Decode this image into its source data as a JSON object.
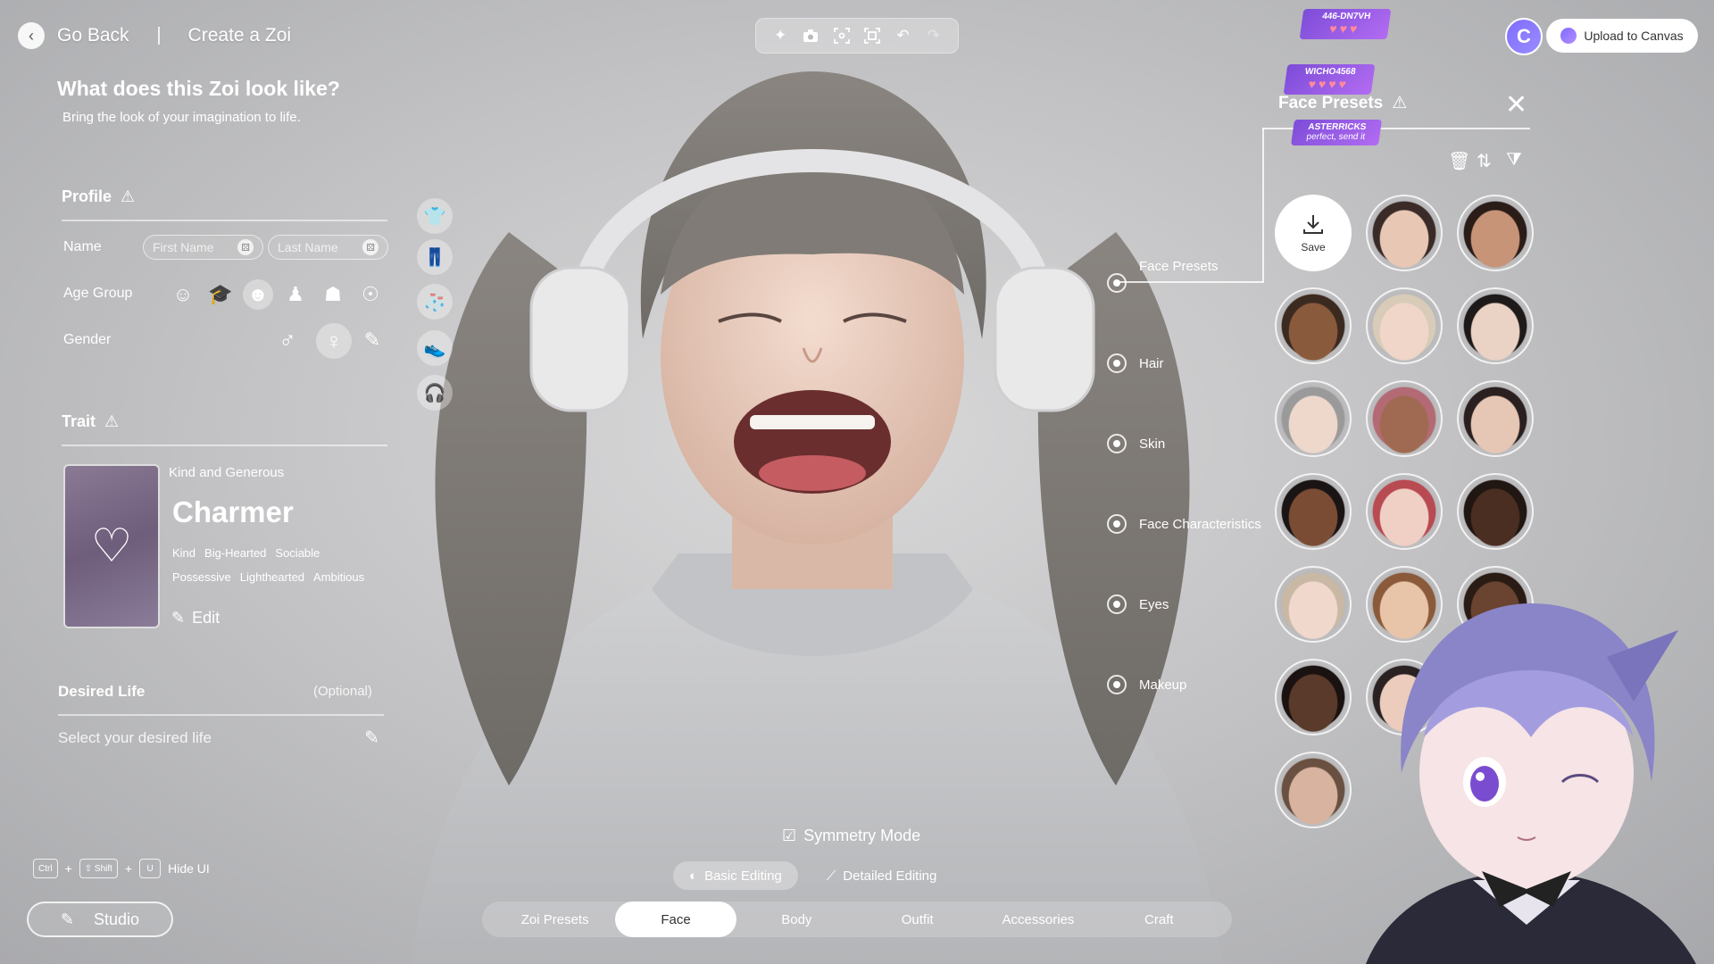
{
  "header": {
    "back_label": "Go Back",
    "title": "Create a Zoi"
  },
  "toolbar": {
    "tools": [
      "sparkle-icon",
      "camera-icon",
      "focus-icon",
      "capture-icon",
      "undo-icon",
      "redo-icon"
    ]
  },
  "top_right": {
    "upload_label": "Upload to Canvas",
    "canvas_badge": "C"
  },
  "main": {
    "heading": "What does this Zoi look like?",
    "subheading": "Bring the look of your imagination to life."
  },
  "profile": {
    "title": "Profile",
    "name_label": "Name",
    "first_name_placeholder": "First Name",
    "last_name_placeholder": "Last Name",
    "age_label": "Age Group",
    "gender_label": "Gender"
  },
  "trait": {
    "title": "Trait",
    "subtitle": "Kind and Generous",
    "name": "Charmer",
    "tags_row1": [
      "Kind",
      "Big-Hearted",
      "Sociable"
    ],
    "tags_row2": [
      "Possessive",
      "Lighthearted",
      "Ambitious"
    ],
    "edit_label": "Edit"
  },
  "desired_life": {
    "title": "Desired Life",
    "optional": "(Optional)",
    "placeholder": "Select your desired life"
  },
  "face_menu": {
    "items": [
      "Face Presets",
      "Hair",
      "Skin",
      "Face Characteristics",
      "Eyes",
      "Makeup"
    ]
  },
  "presets": {
    "title": "Face Presets",
    "save_label": "Save",
    "faces": [
      {
        "skin": "#e8c8b4",
        "hair": "#3a2b28"
      },
      {
        "skin": "#c89478",
        "hair": "#2a1d18"
      },
      {
        "skin": "#8a5a3c",
        "hair": "#3b2a20"
      },
      {
        "skin": "#efd6c8",
        "hair": "#d8cbb8"
      },
      {
        "skin": "#ead2c4",
        "hair": "#1f1a1a"
      },
      {
        "skin": "#eed8cc",
        "hair": "#9a9a9a"
      },
      {
        "skin": "#a06a52",
        "hair": "#b46a74"
      },
      {
        "skin": "#e6c6b4",
        "hair": "#2a2020"
      },
      {
        "skin": "#7a4c34",
        "hair": "#1a1414"
      },
      {
        "skin": "#f0d0c4",
        "hair": "#b84a52"
      },
      {
        "skin": "#4a2e22",
        "hair": "#201612"
      },
      {
        "skin": "#f0d8cc",
        "hair": "#c8b8a4"
      },
      {
        "skin": "#e8c4a8",
        "hair": "#8a5a3a"
      },
      {
        "skin": "#6a4430",
        "hair": "#2a1c14"
      },
      {
        "skin": "#5a3a2a",
        "hair": "#1a1210"
      },
      {
        "skin": "#ecccbc",
        "hair": "#2a2222"
      },
      {
        "skin": "#e8c8b8",
        "hair": "#2a2020"
      },
      {
        "skin": "#d8b4a0",
        "hair": "#6a5040"
      }
    ]
  },
  "chat": [
    {
      "user": "446-DN7VH",
      "msg": ""
    },
    {
      "user": "WICHO4568",
      "msg": ""
    },
    {
      "user": "ASTERRICKS",
      "msg": "perfect, send it"
    }
  ],
  "editing": {
    "symmetry_label": "Symmetry Mode",
    "basic_label": "Basic Editing",
    "detailed_label": "Detailed Editing"
  },
  "tabs": [
    "Zoi Presets",
    "Face",
    "Body",
    "Outfit",
    "Accessories",
    "Craft"
  ],
  "hotkeys": {
    "ctrl": "Ctrl",
    "shift": "⇧ Shift",
    "u": "U",
    "plus": "+",
    "label": "Hide UI"
  },
  "studio": {
    "label": "Studio"
  },
  "colors": {
    "accent": "#7f6cff",
    "badge": "#9b5be6"
  }
}
